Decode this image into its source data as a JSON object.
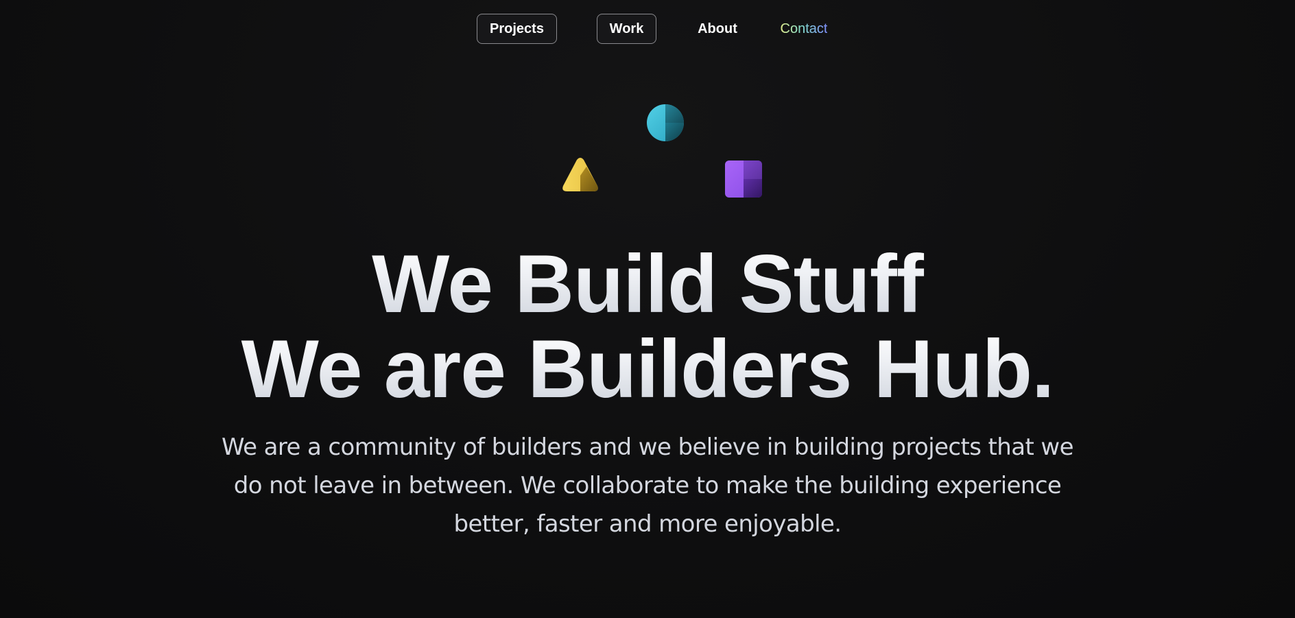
{
  "nav": {
    "items": [
      {
        "label": "Projects"
      },
      {
        "label": "Work"
      },
      {
        "label": "About"
      },
      {
        "label": "Contact"
      }
    ]
  },
  "icons": {
    "circle": {
      "name": "circle-shape-icon",
      "color": "#3fc3dc"
    },
    "triangle": {
      "name": "triangle-shape-icon",
      "color": "#f0cf4b"
    },
    "square": {
      "name": "square-shape-icon",
      "color": "#9b5cf0"
    }
  },
  "hero": {
    "line1": "We Build Stuff",
    "line2": "We are Builders Hub.",
    "subtitle": "We are a community of builders and we believe in building projects that we do not leave in between. We collaborate to make the building experience better, faster and more enjoyable."
  },
  "colors": {
    "background": "#0f0f10",
    "nav_text": "#ffffff",
    "contact_gradient": [
      "#d9e58a",
      "#7fd6c6",
      "#7c8cf5"
    ]
  }
}
